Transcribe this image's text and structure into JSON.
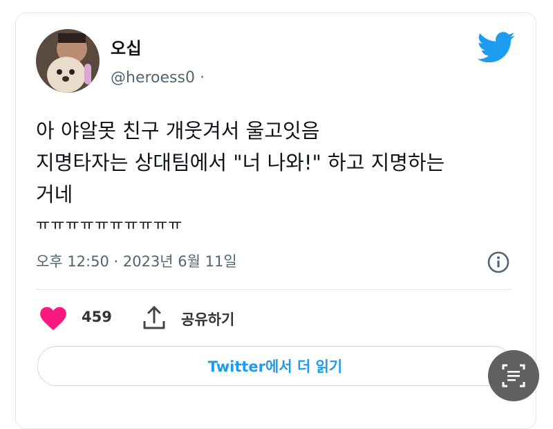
{
  "tweet": {
    "display_name": "오십",
    "handle": "@heroess0",
    "handle_separator": "·",
    "text_lines": [
      "아 야알못 친구 개웃겨서 울고잇음",
      "지명타자는 상대팀에서 \"너 나와!\" 하고 지명하는",
      "거네",
      "ㅠㅠㅠㅠㅠㅠㅠㅠㅠㅠ"
    ],
    "timestamp": "오후 12:50 · 2023년 6월 11일",
    "likes": "459",
    "share_label": "공유하기",
    "read_more_label": "Twitter에서 더 읽기"
  },
  "colors": {
    "twitter_blue": "#1d9bf0",
    "like_pink": "#f91880",
    "text_secondary": "#536471"
  },
  "icons": [
    "twitter-logo-icon",
    "info-icon",
    "heart-icon",
    "share-icon",
    "scan-text-icon"
  ]
}
